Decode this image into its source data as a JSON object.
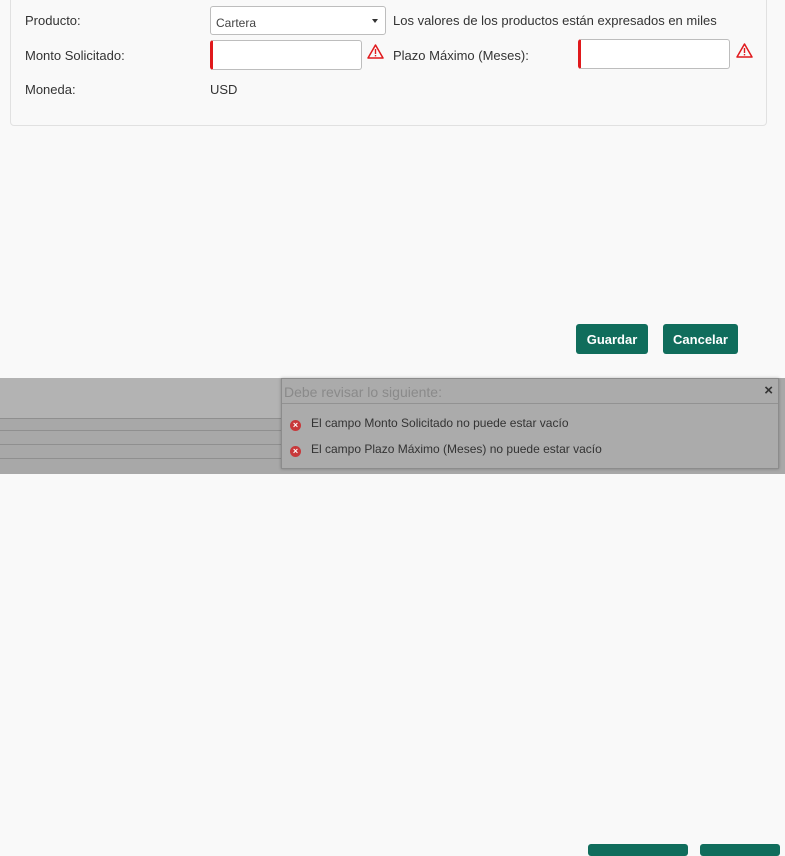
{
  "form": {
    "producto_label": "Producto:",
    "producto_value": "Cartera",
    "producto_note": "Los valores de los productos están expresados en miles",
    "monto_label": "Monto Solicitado:",
    "monto_value": "",
    "plazo_label": "Plazo Máximo (Meses):",
    "plazo_value": "",
    "moneda_label": "Moneda:",
    "moneda_value": "USD"
  },
  "buttons": {
    "guardar": "Guardar",
    "cancelar": "Cancelar"
  },
  "toast": {
    "title": "Debe revisar lo siguiente:",
    "close": "×",
    "errors": [
      {
        "prefix": "El campo ",
        "field": "Monto Solicitado",
        "suffix": " no puede estar vacío"
      },
      {
        "prefix": "El campo ",
        "field": "Plazo Máximo (Meses)",
        "suffix": " no puede estar vacío"
      }
    ]
  },
  "colors": {
    "accent": "#106d5c",
    "error": "#e0191c"
  }
}
